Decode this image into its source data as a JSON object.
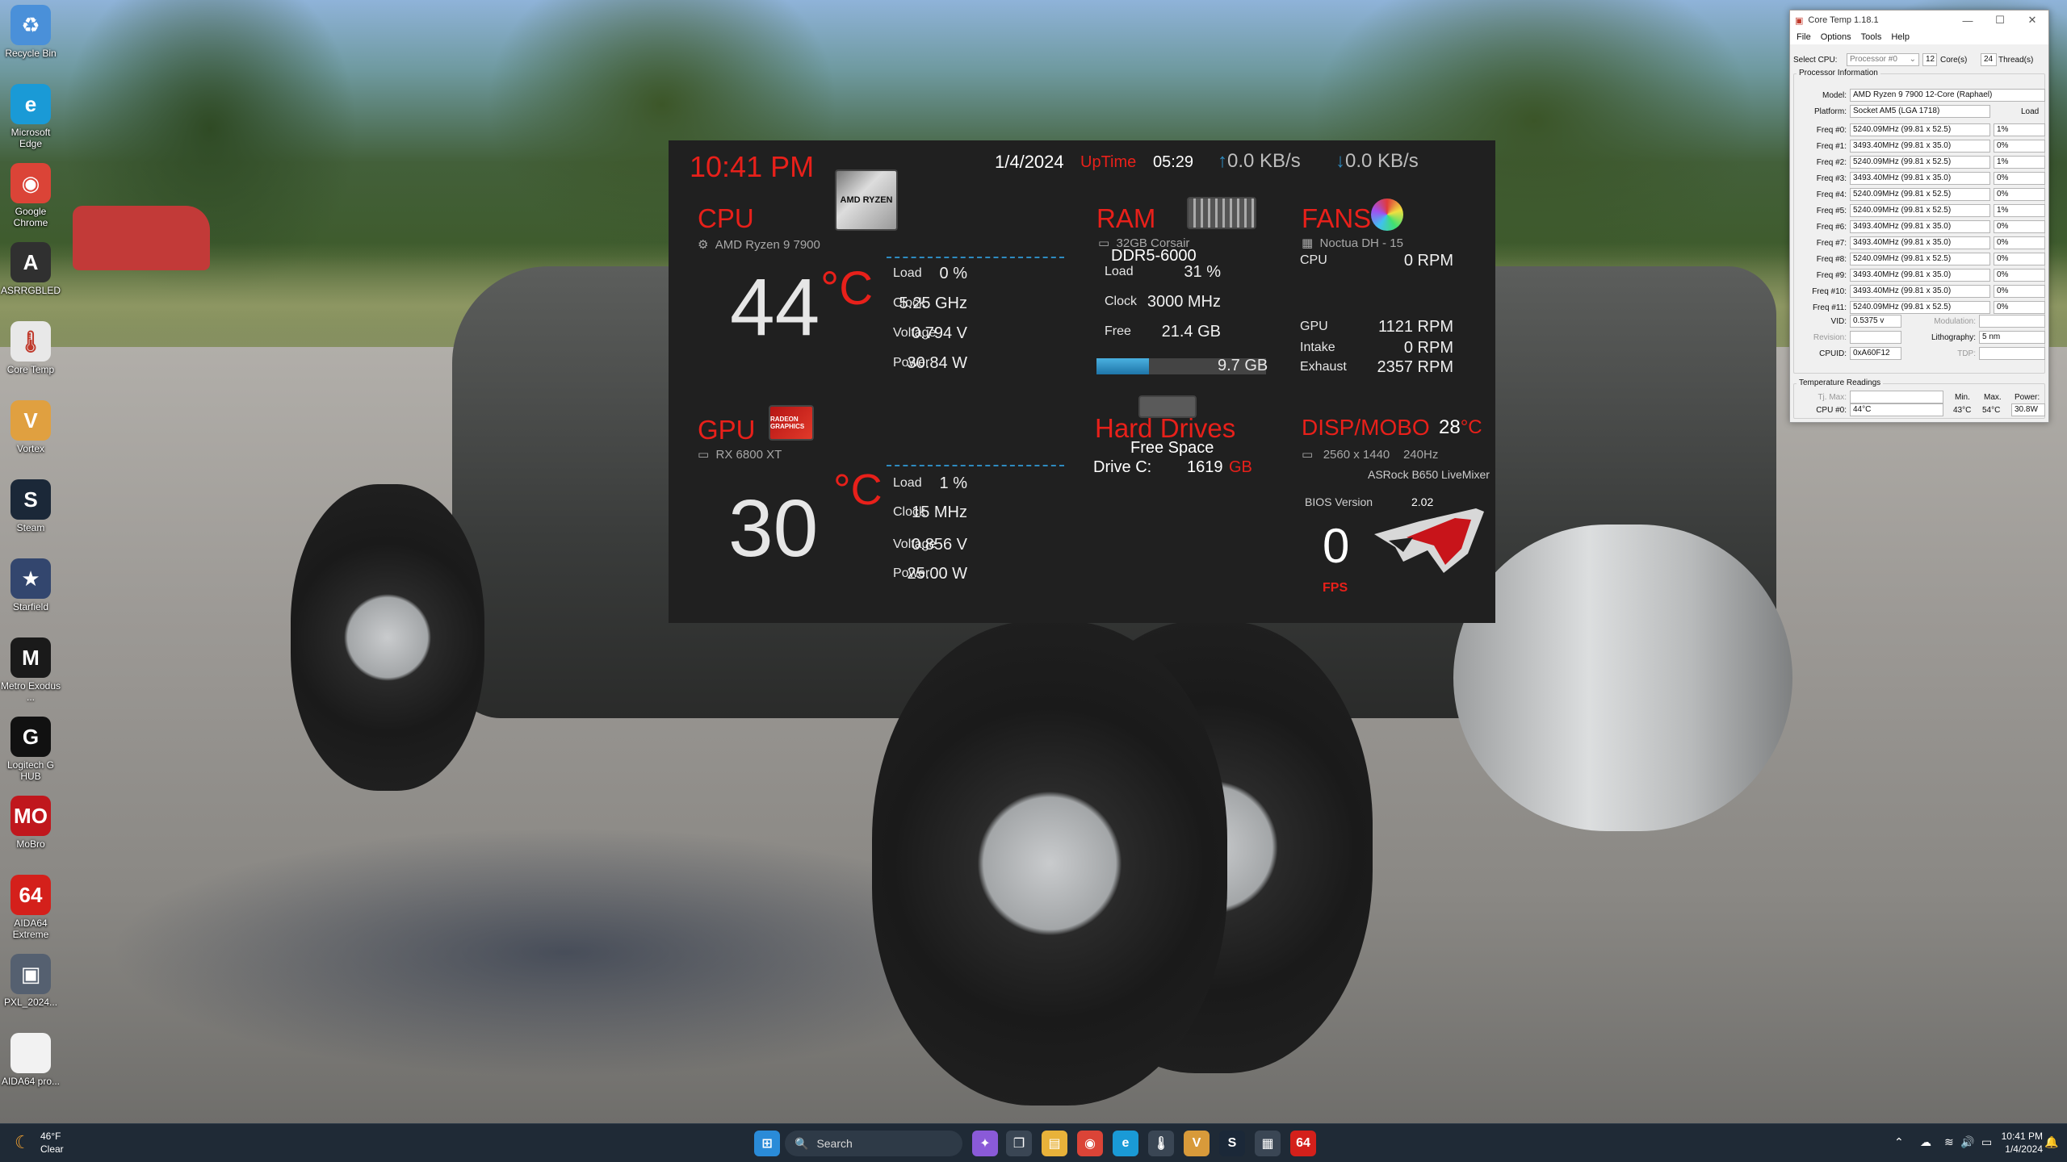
{
  "desktop_icons": [
    {
      "label": "Recycle Bin",
      "icon": "recycle-bin-icon",
      "color": "#4a90d9",
      "glyph": "♻"
    },
    {
      "label": "Microsoft Edge",
      "icon": "edge-icon",
      "color": "#1a9ad6",
      "glyph": "e"
    },
    {
      "label": "Google Chrome",
      "icon": "chrome-icon",
      "color": "#db4437",
      "glyph": "◉"
    },
    {
      "label": "ASRRGBLED",
      "icon": "asrock-rgb-icon",
      "color": "#303030",
      "glyph": "A"
    },
    {
      "label": "Core Temp",
      "icon": "core-temp-icon",
      "color": "#e8e8e8",
      "glyph": "🌡"
    },
    {
      "label": "Vortex",
      "icon": "vortex-icon",
      "color": "#e0a040",
      "glyph": "V"
    },
    {
      "label": "Steam",
      "icon": "steam-icon",
      "color": "#1b2838",
      "glyph": "S"
    },
    {
      "label": "Starfield",
      "icon": "starfield-icon",
      "color": "#33466e",
      "glyph": "★"
    },
    {
      "label": "Metro Exodus ...",
      "icon": "metro-exodus-icon",
      "color": "#1a1a1a",
      "glyph": "M"
    },
    {
      "label": "Logitech G HUB",
      "icon": "logitech-ghub-icon",
      "color": "#111111",
      "glyph": "G"
    },
    {
      "label": "MoBro",
      "icon": "mobro-icon",
      "color": "#c0171d",
      "glyph": "MO"
    },
    {
      "label": "AIDA64 Extreme",
      "icon": "aida64-icon",
      "color": "#d4201b",
      "glyph": "64"
    },
    {
      "label": "PXL_2024...",
      "icon": "image-file-icon",
      "color": "#556070",
      "glyph": "▣"
    },
    {
      "label": "AIDA64 pro...",
      "icon": "document-icon",
      "color": "#f2f2f2",
      "glyph": " "
    }
  ],
  "widget": {
    "time": "10:41 PM",
    "date": "1/4/2024",
    "uptime_label": "UpTime",
    "uptime": "05:29",
    "upload": "0.0 KB/s",
    "download": "0.0 KB/s",
    "cpu": {
      "title": "CPU",
      "name": "AMD Ryzen 9 7900",
      "chip_text": "AMD RYZEN",
      "temp": "44",
      "unit": "°C",
      "rows": [
        {
          "label": "Load",
          "value": "0 %"
        },
        {
          "label": "Clock",
          "value": "5.25 GHz"
        },
        {
          "label": "Voltage",
          "value": "0.794 V"
        },
        {
          "label": "Power",
          "value": "30.84 W"
        }
      ]
    },
    "gpu": {
      "title": "GPU",
      "name": "RX 6800 XT",
      "chip_text": "RADEON GRAPHICS",
      "temp": "30",
      "unit": "°C",
      "rows": [
        {
          "label": "Load",
          "value": "1 %"
        },
        {
          "label": "Clock",
          "value": "15 MHz"
        },
        {
          "label": "Voltage",
          "value": "0.856 V"
        },
        {
          "label": "Power",
          "value": "25.00 W"
        }
      ]
    },
    "ram": {
      "title": "RAM",
      "name": "32GB Corsair",
      "type": "DDR5-6000",
      "rows": [
        {
          "label": "Load",
          "value": "31 %"
        },
        {
          "label": "Clock",
          "value": "3000 MHz"
        },
        {
          "label": "Free",
          "value": "21.4 GB"
        }
      ],
      "used": "9.7 GB",
      "used_fraction": 0.31
    },
    "fans": {
      "title": "FANS",
      "name": "Noctua DH - 15",
      "rows": [
        {
          "label": "CPU",
          "value": "0 RPM"
        },
        {
          "label": "GPU",
          "value": "1121 RPM"
        },
        {
          "label": "Intake",
          "value": "0 RPM"
        },
        {
          "label": "Exhaust",
          "value": "2357 RPM"
        }
      ]
    },
    "drives": {
      "title": "Hard Drives",
      "subtitle": "Free Space",
      "drive_label": "Drive C:",
      "drive_value": "1619",
      "drive_unit": "GB"
    },
    "disp": {
      "title": "DISP/MOBO",
      "temp": "28",
      "unit": "°C",
      "resolution": "2560 x 1440",
      "refresh": "240Hz",
      "board": "ASRock B650 LiveMixer",
      "bios_label": "BIOS Version",
      "bios_value": "2.02",
      "fps": "0",
      "fps_label": "FPS"
    },
    "colors": {
      "accent": "#e8201a",
      "bar": "#2e8bc0",
      "bg": "#202020"
    }
  },
  "core_temp": {
    "title": "Core Temp 1.18.1",
    "menu": [
      "File",
      "Options",
      "Tools",
      "Help"
    ],
    "select_cpu_label": "Select CPU:",
    "select_cpu_value": "Processor #0",
    "cores": "12",
    "cores_label": "Core(s)",
    "threads": "24",
    "threads_label": "Thread(s)",
    "proc_info_label": "Processor Information",
    "model_label": "Model:",
    "model": "AMD Ryzen 9 7900 12-Core (Raphael)",
    "platform_label": "Platform:",
    "platform": "Socket AM5 (LGA 1718)",
    "load_header": "Load",
    "freqs": [
      {
        "label": "Freq #0:",
        "value": "5240.09MHz (99.81 x 52.5)",
        "load": "1%"
      },
      {
        "label": "Freq #1:",
        "value": "3493.40MHz (99.81 x 35.0)",
        "load": "0%"
      },
      {
        "label": "Freq #2:",
        "value": "5240.09MHz (99.81 x 52.5)",
        "load": "1%"
      },
      {
        "label": "Freq #3:",
        "value": "3493.40MHz (99.81 x 35.0)",
        "load": "0%"
      },
      {
        "label": "Freq #4:",
        "value": "5240.09MHz (99.81 x 52.5)",
        "load": "0%"
      },
      {
        "label": "Freq #5:",
        "value": "5240.09MHz (99.81 x 52.5)",
        "load": "1%"
      },
      {
        "label": "Freq #6:",
        "value": "3493.40MHz (99.81 x 35.0)",
        "load": "0%"
      },
      {
        "label": "Freq #7:",
        "value": "3493.40MHz (99.81 x 35.0)",
        "load": "0%"
      },
      {
        "label": "Freq #8:",
        "value": "5240.09MHz (99.81 x 52.5)",
        "load": "0%"
      },
      {
        "label": "Freq #9:",
        "value": "3493.40MHz (99.81 x 35.0)",
        "load": "0%"
      },
      {
        "label": "Freq #10:",
        "value": "3493.40MHz (99.81 x 35.0)",
        "load": "0%"
      },
      {
        "label": "Freq #11:",
        "value": "5240.09MHz (99.81 x 52.5)",
        "load": "0%"
      }
    ],
    "vid_label": "VID:",
    "vid": "0.5375 v",
    "modulation_label": "Modulation:",
    "revision_label": "Revision:",
    "lithography_label": "Lithography:",
    "lithography": "5 nm",
    "cpuid_label": "CPUID:",
    "cpuid": "0xA60F12",
    "tdp_label": "TDP:",
    "temp_readings_label": "Temperature Readings",
    "tjmax_label": "Tj. Max:",
    "min_label": "Min.",
    "max_label": "Max.",
    "power_label": "Power:",
    "cpu0_label": "CPU #0:",
    "cpu0_temp": "44°C",
    "cpu0_min": "43°C",
    "cpu0_max": "54°C",
    "cpu0_power": "30.8W"
  },
  "taskbar": {
    "weather_temp": "46°F",
    "weather_desc": "Clear",
    "search_placeholder": "Search",
    "clock_time": "10:41 PM",
    "clock_date": "1/4/2024",
    "apps": [
      {
        "icon": "start-icon",
        "glyph": "⊞",
        "color": "#2a8bd8"
      },
      {
        "icon": "copilot-icon",
        "glyph": "✦",
        "color": "#8a5ad8"
      },
      {
        "icon": "task-view-icon",
        "glyph": "❐",
        "color": "#3a4654"
      },
      {
        "icon": "file-explorer-icon",
        "glyph": "▤",
        "color": "#e8b23a"
      },
      {
        "icon": "chrome-icon",
        "glyph": "◉",
        "color": "#db4437"
      },
      {
        "icon": "edge-icon",
        "glyph": "e",
        "color": "#1a9ad6"
      },
      {
        "icon": "core-temp-icon",
        "glyph": "🌡",
        "color": "#3a4654"
      },
      {
        "icon": "vortex-icon",
        "glyph": "V",
        "color": "#d89a3a"
      },
      {
        "icon": "steam-icon",
        "glyph": "S",
        "color": "#1b2838"
      },
      {
        "icon": "calculator-icon",
        "glyph": "▦",
        "color": "#3a4654"
      },
      {
        "icon": "aida64-icon",
        "glyph": "64",
        "color": "#d4201b"
      }
    ]
  }
}
